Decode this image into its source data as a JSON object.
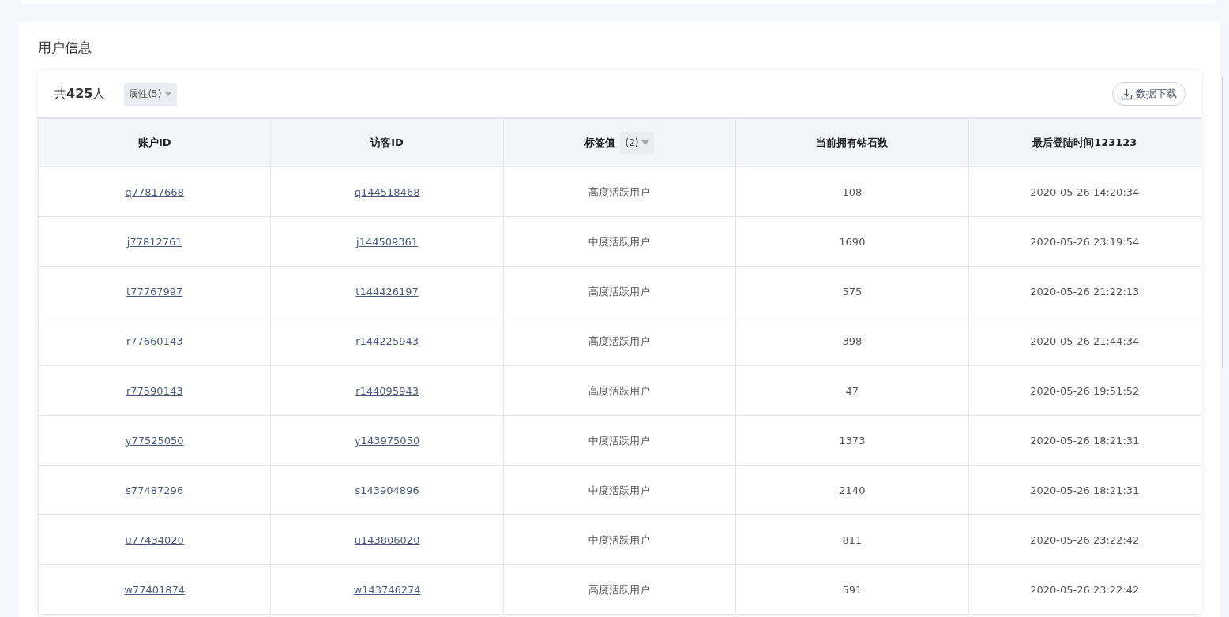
{
  "section_title": "用户信息",
  "toolbar": {
    "total": "共**425**人",
    "attribute_filter": "属性(5)",
    "download_button": "数据下载"
  },
  "table": {
    "columns": [
      {
        "label": "账户ID"
      },
      {
        "label": "访客ID"
      },
      {
        "label": "标签值",
        "filter": "(2)"
      },
      {
        "label": "当前拥有钻石数"
      },
      {
        "label": "最后登陆时间123123"
      }
    ],
    "rows": [
      {
        "account_id": "q77817668",
        "visitor_id": "q144518468",
        "tag": "高度活跃用户",
        "diamonds": "108",
        "last_login": "2020-05-26 14:20:34"
      },
      {
        "account_id": "j77812761",
        "visitor_id": "j144509361",
        "tag": "中度活跃用户",
        "diamonds": "1690",
        "last_login": "2020-05-26 23:19:54"
      },
      {
        "account_id": "t77767997",
        "visitor_id": "t144426197",
        "tag": "高度活跃用户",
        "diamonds": "575",
        "last_login": "2020-05-26 21:22:13"
      },
      {
        "account_id": "r77660143",
        "visitor_id": "r144225943",
        "tag": "高度活跃用户",
        "diamonds": "398",
        "last_login": "2020-05-26 21:44:34"
      },
      {
        "account_id": "r77590143",
        "visitor_id": "r144095943",
        "tag": "高度活跃用户",
        "diamonds": "47",
        "last_login": "2020-05-26 19:51:52"
      },
      {
        "account_id": "y77525050",
        "visitor_id": "y143975050",
        "tag": "中度活跃用户",
        "diamonds": "1373",
        "last_login": "2020-05-26 18:21:31"
      },
      {
        "account_id": "s77487296",
        "visitor_id": "s143904896",
        "tag": "中度活跃用户",
        "diamonds": "2140",
        "last_login": "2020-05-26 18:21:31"
      },
      {
        "account_id": "u77434020",
        "visitor_id": "u143806020",
        "tag": "中度活跃用户",
        "diamonds": "811",
        "last_login": "2020-05-26 23:22:42"
      },
      {
        "account_id": "w77401874",
        "visitor_id": "w143746274",
        "tag": "高度活跃用户",
        "diamonds": "591",
        "last_login": "2020-05-26 23:22:42"
      }
    ]
  }
}
